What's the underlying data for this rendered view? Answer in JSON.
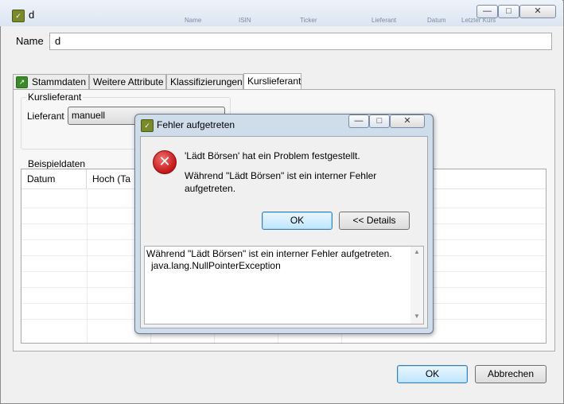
{
  "window": {
    "title": "d",
    "minimize_glyph": "—",
    "maximize_glyph": "□",
    "close_glyph": "✕",
    "bg_header_labels": [
      "Name",
      "ISIN",
      "Ticker",
      "Lieferant",
      "Datum",
      "Letzter Kurs"
    ]
  },
  "name_field": {
    "label": "Name",
    "value": "d"
  },
  "tabs": [
    {
      "label": "Stammdaten"
    },
    {
      "label": "Weitere Attribute"
    },
    {
      "label": "Klassifizierungen"
    },
    {
      "label": "Kurslieferant"
    }
  ],
  "kurslieferant": {
    "group_label": "Kurslieferant",
    "lieferant_label": "Lieferant",
    "lieferant_value": "manuell"
  },
  "beispieldaten": {
    "group_label": "Beispieldaten",
    "columns": [
      "Datum",
      "Hoch (Ta"
    ]
  },
  "footer": {
    "ok_label": "OK",
    "cancel_label": "Abbrechen"
  },
  "dialog": {
    "title": "Fehler aufgetreten",
    "message1": "'Lädt Börsen' hat ein Problem festgestellt.",
    "message2": "Während \"Lädt Börsen\" ist ein interner Fehler aufgetreten.",
    "ok_label": "OK",
    "details_label": "<< Details",
    "details_line1": "Während \"Lädt Börsen\" ist ein interner Fehler aufgetreten.",
    "details_line2": "java.lang.NullPointerException",
    "minimize_glyph": "—",
    "maximize_glyph": "□",
    "close_glyph": "✕",
    "error_glyph": "✕"
  },
  "colors": {
    "error_red": "#c41616",
    "default_button_border": "#3c7fb1",
    "title_bar": "#dbe5f1"
  }
}
